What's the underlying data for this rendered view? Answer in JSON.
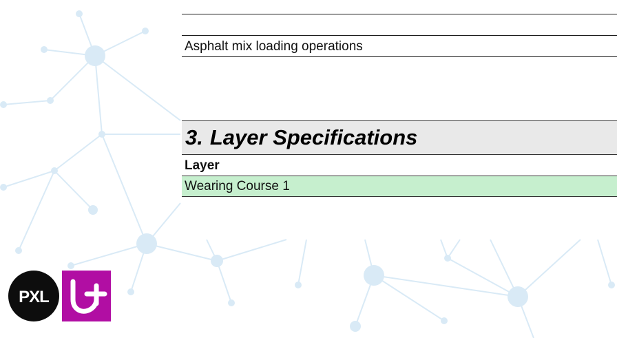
{
  "background": {
    "network_color": "#d9eaf6"
  },
  "sheet": {
    "loading_row": "Asphalt mix loading operations",
    "section": {
      "number": "3.",
      "title": "Layer Specifications",
      "header_fill": "#e9e9e9"
    },
    "layer_label": "Layer",
    "layer_value": "Wearing Course 1",
    "layer_value_fill": "#c6efce"
  },
  "logos": {
    "pxl": {
      "text": "PXL",
      "color": "#0d0d0d"
    },
    "ucll": {
      "color": "#b10ea3"
    }
  }
}
